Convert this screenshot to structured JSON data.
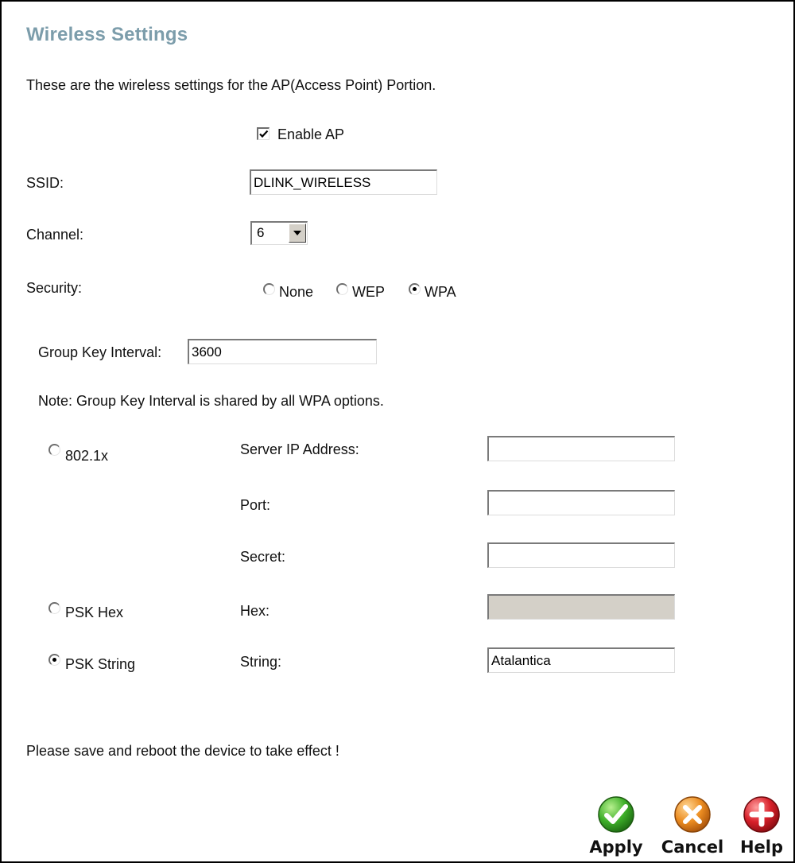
{
  "page": {
    "title": "Wireless Settings",
    "description": "These are the wireless settings for the AP(Access Point) Portion.",
    "footer_note": "Please save and reboot the device to take effect !"
  },
  "enable_ap": {
    "label": "Enable AP",
    "checked": true
  },
  "ssid": {
    "label": "SSID:",
    "value": "DLINK_WIRELESS"
  },
  "channel": {
    "label": "Channel:",
    "value": "6"
  },
  "security": {
    "label": "Security:",
    "options": [
      "None",
      "WEP",
      "WPA"
    ],
    "selected": "WPA"
  },
  "group_key": {
    "label": "Group Key Interval:",
    "value": "3600",
    "note": "Note: Group Key Interval is shared by all WPA options."
  },
  "wpa_modes": {
    "selected": "PSK String",
    "dot1x": {
      "label": "802.1x",
      "server_ip_label": "Server IP Address:",
      "server_ip_value": "",
      "port_label": "Port:",
      "port_value": "",
      "secret_label": "Secret:",
      "secret_value": ""
    },
    "psk_hex": {
      "label": "PSK Hex",
      "field_label": "Hex:",
      "value": ""
    },
    "psk_string": {
      "label": "PSK String",
      "field_label": "String:",
      "value": "Atalantica"
    }
  },
  "actions": {
    "apply": {
      "label": "Apply",
      "icon": "check-icon",
      "color": "#3aa52a"
    },
    "cancel": {
      "label": "Cancel",
      "icon": "x-icon",
      "color": "#e98a1f"
    },
    "help": {
      "label": "Help",
      "icon": "plus-icon",
      "color": "#d6202a"
    }
  }
}
